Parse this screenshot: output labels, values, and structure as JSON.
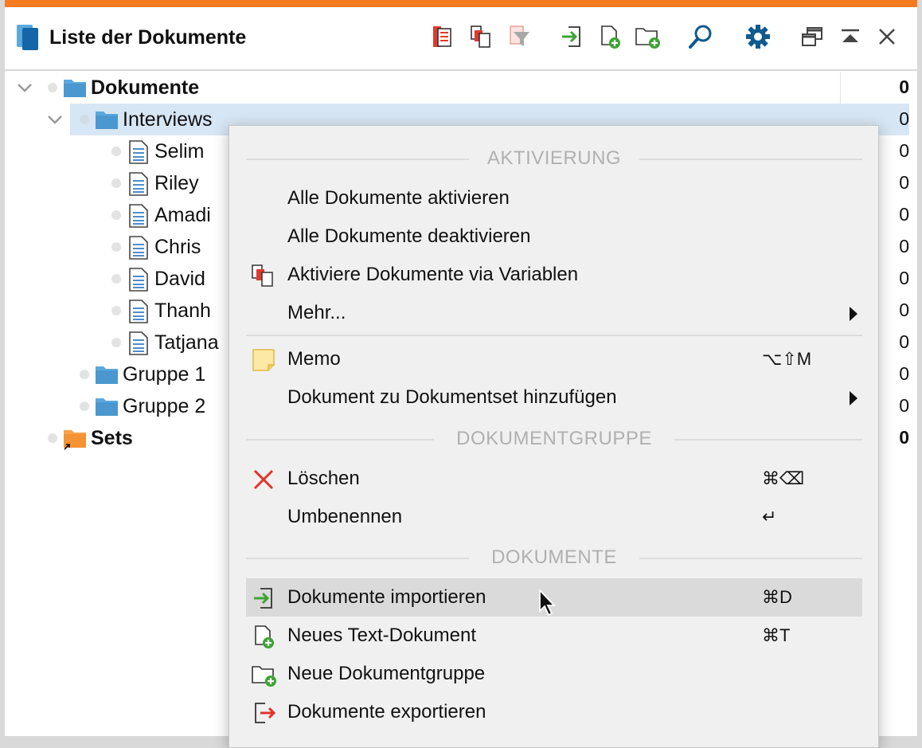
{
  "window": {
    "title": "Liste der Dokumente",
    "accent_color": "#f57b21"
  },
  "toolbar": {
    "icons": [
      "activate-via-variables-icon",
      "activate-documents-icon",
      "filter-icon",
      "import-icon",
      "new-document-icon",
      "new-folder-icon",
      "search-icon",
      "settings-icon",
      "undock-icon",
      "collapse-icon",
      "close-icon"
    ]
  },
  "tree": {
    "rows": [
      {
        "label": "Dokumente",
        "count": "0",
        "bold": true
      },
      {
        "label": "Interviews",
        "count": "0",
        "bold": false,
        "selected": true
      },
      {
        "label": "Selim",
        "count": "0"
      },
      {
        "label": "Riley",
        "count": "0"
      },
      {
        "label": "Amadi",
        "count": "0"
      },
      {
        "label": "Chris",
        "count": "0"
      },
      {
        "label": "David",
        "count": "0"
      },
      {
        "label": "Thanh",
        "count": "0"
      },
      {
        "label": "Tatjana",
        "count": "0"
      },
      {
        "label": "Gruppe 1",
        "count": "0"
      },
      {
        "label": "Gruppe 2",
        "count": "0"
      },
      {
        "label": "Sets",
        "count": "0",
        "bold": true
      }
    ]
  },
  "context_menu": {
    "sections": {
      "activation": "AKTIVIERUNG",
      "group": "DOKUMENTGRUPPE",
      "documents": "DOKUMENTE"
    },
    "items": {
      "activate_all": {
        "label": "Alle Dokumente aktivieren"
      },
      "deactivate_all": {
        "label": "Alle Dokumente deaktivieren"
      },
      "activate_via_variables": {
        "label": "Aktiviere Dokumente via Variablen"
      },
      "more": {
        "label": "Mehr..."
      },
      "memo": {
        "label": "Memo",
        "shortcut": "⌥⇧M"
      },
      "add_to_set": {
        "label": "Dokument zu Dokumentset hinzufügen"
      },
      "delete": {
        "label": "Löschen",
        "shortcut": "⌘⌫"
      },
      "rename": {
        "label": "Umbenennen",
        "shortcut": "↵"
      },
      "import": {
        "label": "Dokumente importieren",
        "shortcut": "⌘D",
        "highlighted": true
      },
      "new_text": {
        "label": "Neues Text-Dokument",
        "shortcut": "⌘T"
      },
      "new_group": {
        "label": "Neue Dokumentgruppe"
      },
      "export": {
        "label": "Dokumente exportieren"
      }
    }
  }
}
